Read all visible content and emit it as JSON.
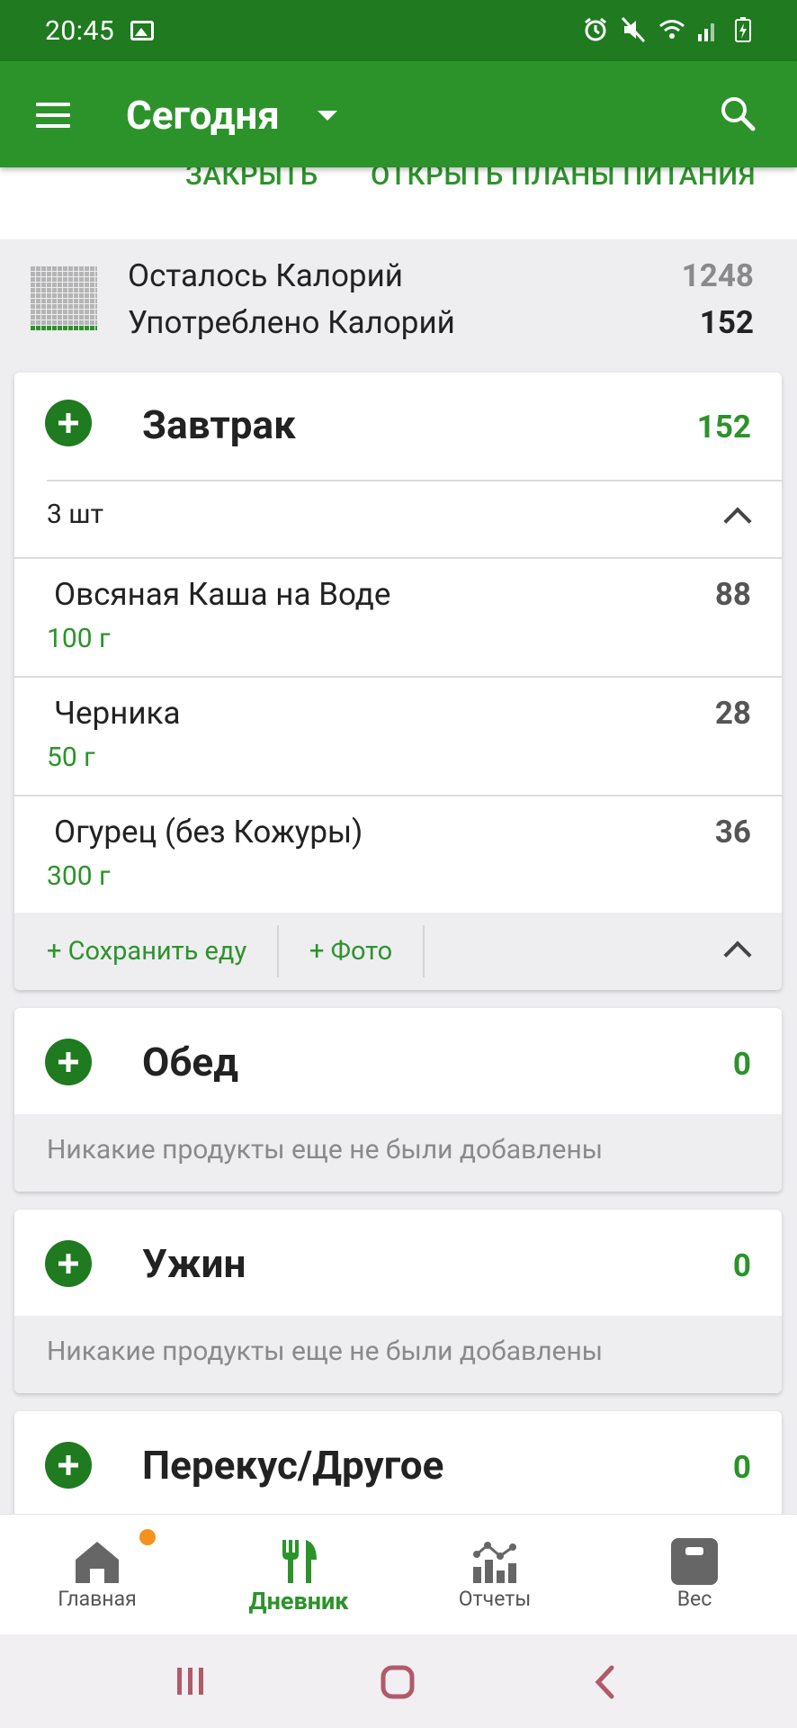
{
  "status_bar": {
    "time": "20:45"
  },
  "app_bar": {
    "title": "Сегодня"
  },
  "banner": {
    "close": "ЗАКРЫТЬ",
    "open_plans": "ОТКРЫТЬ ПЛАНЫ ПИТАНИЯ"
  },
  "summary": {
    "remaining_label": "Осталось Калорий",
    "remaining_value": "1248",
    "consumed_label": "Употреблено Калорий",
    "consumed_value": "152"
  },
  "meals": {
    "breakfast": {
      "title": "Завтрак",
      "calories": "152",
      "count": "3 шт",
      "items": [
        {
          "name": "Овсяная Каша на Воде",
          "qty": "100 г",
          "cal": "88"
        },
        {
          "name": "Черника",
          "qty": "50 г",
          "cal": "28"
        },
        {
          "name": "Огурец (без Кожуры)",
          "qty": "300 г",
          "cal": "36"
        }
      ],
      "save_food": "+ Сохранить еду",
      "photo": "+ Фото"
    },
    "lunch": {
      "title": "Обед",
      "calories": "0",
      "empty": "Никакие продукты еще не были добавлены"
    },
    "dinner": {
      "title": "Ужин",
      "calories": "0",
      "empty": "Никакие продукты еще не были добавлены"
    },
    "snack": {
      "title": "Перекус/Другое",
      "calories": "0"
    }
  },
  "bottom_nav": {
    "home": "Главная",
    "diary": "Дневник",
    "reports": "Отчеты",
    "weight": "Вес"
  },
  "colors": {
    "primary": "#2c932b",
    "primary_dark": "#1f7a20",
    "badge": "#f5921e"
  }
}
